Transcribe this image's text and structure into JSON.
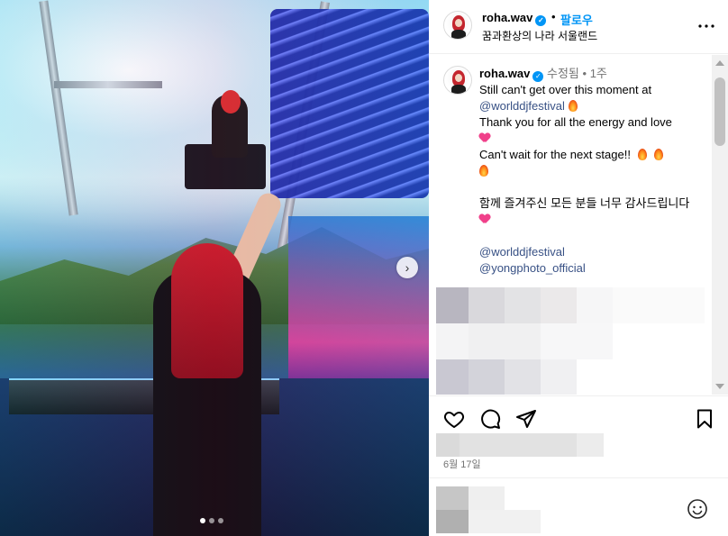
{
  "post": {
    "username": "roha.wav",
    "follow_label": "팔로우",
    "header_separator": "•",
    "location": "꿈과환상의 나라 서울랜드",
    "more_label": "•••"
  },
  "caption": {
    "username": "roha.wav",
    "edited_label": "수정됨",
    "separator": "•",
    "time_ago": "1주",
    "line1": "Still can't get over this moment at",
    "mention1": "@worlddjfestival",
    "line2": "Thank you for all the energy and love",
    "line3": "Can't wait for the next stage!!",
    "line4": "함께 즐겨주신 모든 분들 너무 감사드립니다",
    "mention2": "@worlddjfestival",
    "mention3": "@yongphoto_official"
  },
  "footer": {
    "date": "6월 17일"
  },
  "carousel": {
    "dot_count": 3,
    "active_index": 0
  },
  "colors": {
    "accent_blue": "#0095f6",
    "mention_blue": "#385185",
    "muted_text": "#737373"
  },
  "icons": [
    "verified-badge",
    "more-options-icon",
    "fire-emoji",
    "heart-emoji",
    "next-slide-icon",
    "like-heart-icon",
    "comment-icon",
    "share-icon",
    "save-bookmark-icon",
    "emoji-icon"
  ]
}
